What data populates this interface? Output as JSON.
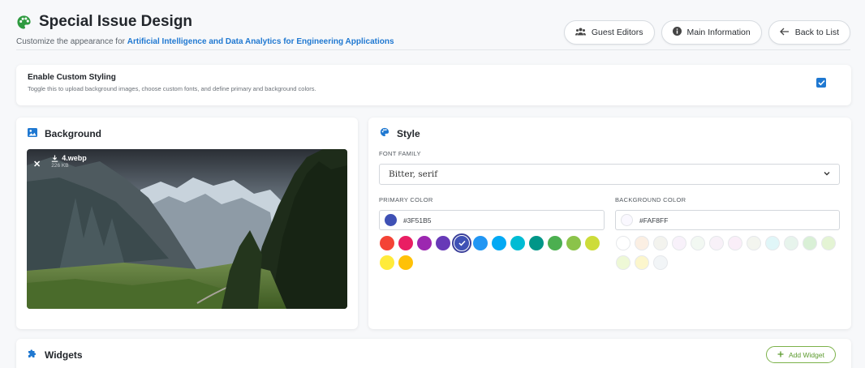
{
  "header": {
    "title": "Special Issue Design",
    "subtitle_prefix": "Customize the appearance for",
    "subtitle_highlight": "Artificial Intelligence and Data Analytics for Engineering Applications",
    "buttons": [
      {
        "label": "Guest Editors",
        "icon": "users-icon"
      },
      {
        "label": "Main Information",
        "icon": "info-icon"
      },
      {
        "label": "Back to List",
        "icon": "arrow-left-icon"
      }
    ]
  },
  "custom_styling": {
    "title": "Enable Custom Styling",
    "description": "Toggle this to upload background images, choose custom fonts, and define primary and background colors.",
    "checked": true
  },
  "background": {
    "title": "Background",
    "file_name": "4.webp",
    "file_size": "226 KB"
  },
  "style": {
    "title": "Style",
    "font_family_label": "FONT FAMILY",
    "font_family_value": "Bitter, serif",
    "primary_color_label": "PRIMARY COLOR",
    "primary_color_value": "#3F51B5",
    "background_color_label": "BACKGROUND COLOR",
    "background_color_value": "#FAF8FF",
    "primary_swatches": [
      "#f44336",
      "#e91e63",
      "#9c27b0",
      "#673ab7",
      "#3f51b5",
      "#2196f3",
      "#03a9f4",
      "#00bcd4",
      "#009688",
      "#4caf50",
      "#8bc34a",
      "#cddc39",
      "#ffeb3b",
      "#ffc107"
    ],
    "primary_selected_index": 4,
    "background_swatches": [
      "#ffffff",
      "#fbefe3",
      "#f3f3ee",
      "#f8f1fa",
      "#f2f8f2",
      "#f8f1f8",
      "#faeef8",
      "#f3f5ef",
      "#e0f6f8",
      "#e7f4ec",
      "#d9f0d6",
      "#e4f4d4",
      "#eef8d6",
      "#fcf6cc",
      "#f2f5f7"
    ]
  },
  "widgets": {
    "title": "Widgets",
    "add_label": "Add Widget"
  }
}
